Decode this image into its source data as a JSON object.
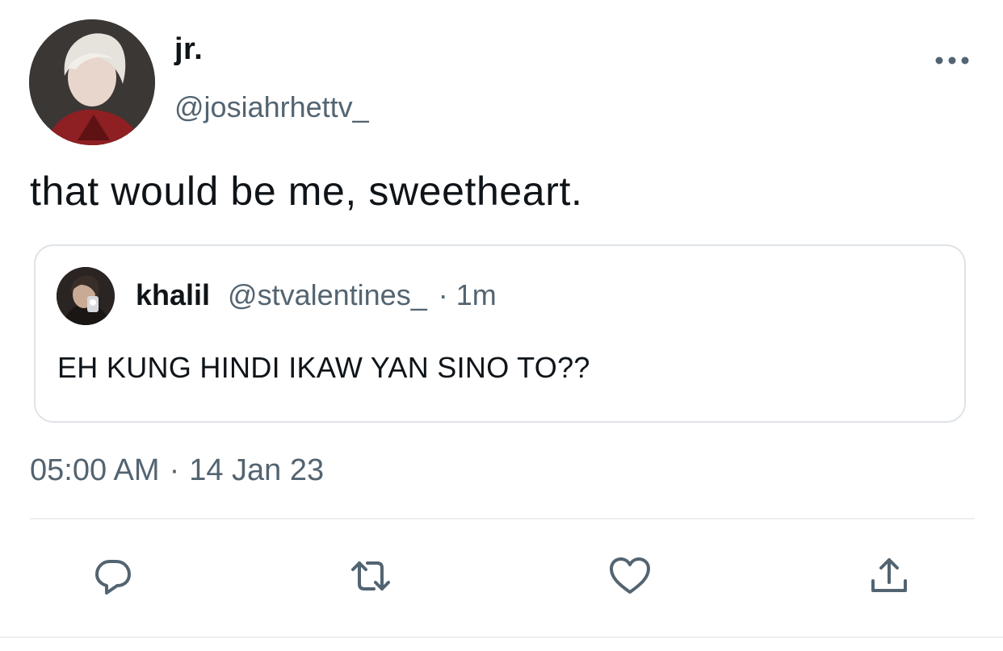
{
  "tweet": {
    "author": {
      "display_name": "jr.",
      "handle": "@josiahrhettv_",
      "avatar_icon": "user-avatar"
    },
    "text": "that would be me, sweetheart.",
    "timestamp": {
      "time": "05:00 AM",
      "separator": "·",
      "date": "14 Jan 23"
    }
  },
  "quoted_tweet": {
    "author": {
      "display_name": "khalil",
      "handle": "@stvalentines_",
      "avatar_icon": "user-avatar"
    },
    "separator": "·",
    "age": "1m",
    "text": "EH KUNG HINDI IKAW YAN SINO TO??"
  },
  "actions": [
    {
      "name": "reply",
      "icon": "reply-icon"
    },
    {
      "name": "retweet",
      "icon": "retweet-icon"
    },
    {
      "name": "like",
      "icon": "heart-icon"
    },
    {
      "name": "share",
      "icon": "share-icon"
    }
  ],
  "colors": {
    "text_primary": "#0f1419",
    "text_secondary": "#536471",
    "border": "#dfe4e8"
  }
}
